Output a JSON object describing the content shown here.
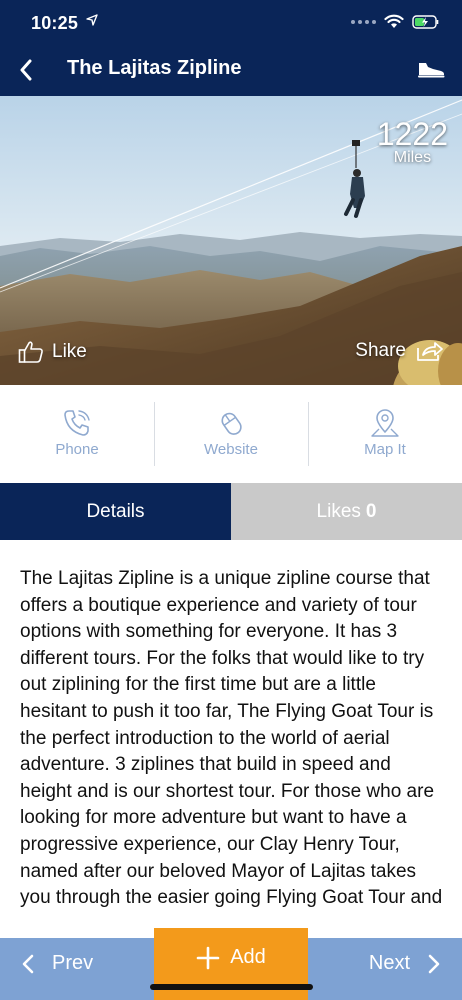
{
  "status_bar": {
    "time": "10:25",
    "location_icon": "location-arrow-icon",
    "wifi_icon": "wifi-icon",
    "battery_icon": "battery-charging-icon"
  },
  "nav": {
    "title": "The Lajitas Zipline",
    "back_icon": "chevron-left-icon",
    "action_icon": "shoe-icon"
  },
  "hero": {
    "distance_value": "1222",
    "distance_unit": "Miles",
    "like_label": "Like",
    "share_label": "Share"
  },
  "actions": [
    {
      "label": "Phone",
      "icon": "phone-icon"
    },
    {
      "label": "Website",
      "icon": "mouse-icon"
    },
    {
      "label": "Map It",
      "icon": "map-pin-icon"
    }
  ],
  "tabs": {
    "details_label": "Details",
    "likes_label": "Likes",
    "likes_count": "0"
  },
  "description": "The Lajitas Zipline is a unique zipline course that offers a boutique experience and variety of tour options with something for everyone. It has 3 different tours. For the folks that would like to try out ziplining for the first time but are a little hesitant to push it too far, The Flying Goat Tour is the perfect introduction to the world of aerial adventure. 3 ziplines that build in speed and height and is our shortest tour. For those who are looking for more adventure but want to have a progressive experience, our Clay Henry Tour, named after our beloved Mayor of Lajitas  takes you through the easier going Flying Goat Tour and",
  "bottom_bar": {
    "prev_label": "Prev",
    "add_label": "Add",
    "next_label": "Next"
  },
  "colors": {
    "navy": "#0a2558",
    "orange": "#f39a1b",
    "light_blue": "#7ea2d3",
    "tab_inactive": "#c9c9c9",
    "action_text": "#8fa9cf"
  }
}
